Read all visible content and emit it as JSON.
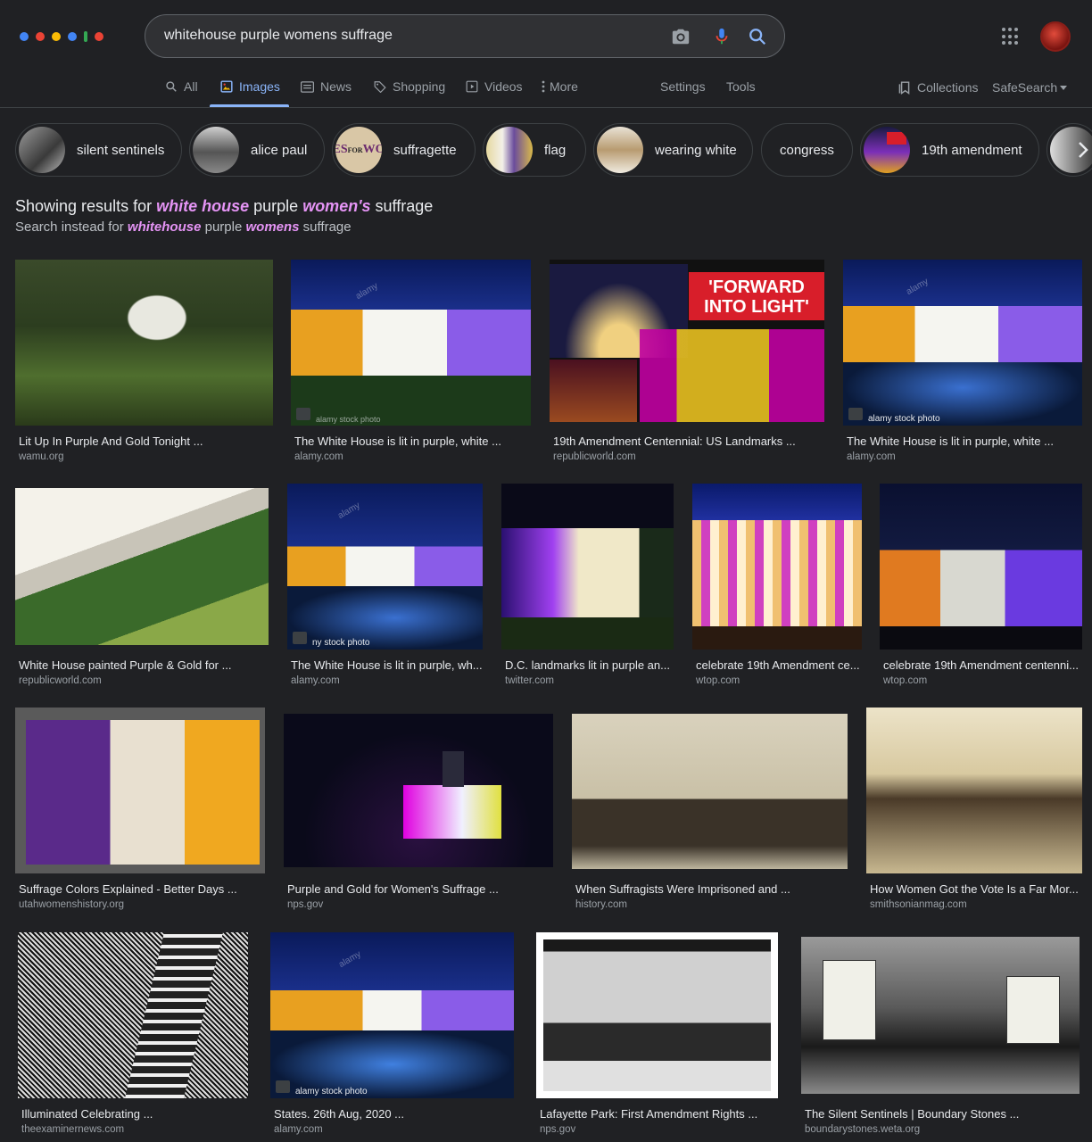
{
  "search": {
    "query": "whitehouse purple womens suffrage"
  },
  "colors": {
    "background": "#202124",
    "accent": "#8ab4f8",
    "highlight": "#e594f5"
  },
  "header_icons": [
    "camera-icon",
    "microphone-icon",
    "search-icon",
    "apps-icon"
  ],
  "tabs": [
    {
      "label": "All",
      "icon": "search-icon"
    },
    {
      "label": "Images",
      "icon": "image-icon",
      "active": true
    },
    {
      "label": "News",
      "icon": "news-icon"
    },
    {
      "label": "Shopping",
      "icon": "tag-icon"
    },
    {
      "label": "Videos",
      "icon": "play-icon"
    },
    {
      "label": "More",
      "icon": "more-vert-icon"
    },
    {
      "label": "Settings"
    },
    {
      "label": "Tools"
    }
  ],
  "right_links": {
    "collections": "Collections",
    "safesearch": "SafeSearch"
  },
  "chips": [
    "silent sentinels",
    "alice paul",
    "suffragette",
    "flag",
    "wearing white",
    "congress",
    "19th amendment"
  ],
  "correction": {
    "showing_prefix": "Showing results for",
    "showing_b1": "white house",
    "showing_mid": "purple",
    "showing_b2": "women's",
    "showing_end": "suffrage",
    "instead_prefix": "Search instead for",
    "instead_b1": "whitehouse",
    "instead_mid": "purple",
    "instead_b2": "womens",
    "instead_end": "suffrage"
  },
  "results": [
    {
      "title": "Lit Up In Purple And Gold Tonight ...",
      "source": "wamu.org"
    },
    {
      "title": "The White House is lit in purple, white ...",
      "source": "alamy.com",
      "watermark": "alamy",
      "stock_label": "alamy stock photo"
    },
    {
      "title": "19th Amendment Centennial: US Landmarks ...",
      "source": "republicworld.com",
      "overlay": "'FORWARD INTO LIGHT'"
    },
    {
      "title": "The White House is lit in purple, white ...",
      "source": "alamy.com",
      "watermark": "alamy",
      "stock_label": "alamy stock photo"
    },
    {
      "title": "White House painted Purple & Gold for ...",
      "source": "republicworld.com"
    },
    {
      "title": "The White House is lit in purple, wh...",
      "source": "alamy.com",
      "watermark": "alamy",
      "stock_label": "ny stock photo"
    },
    {
      "title": "D.C. landmarks lit in purple an...",
      "source": "twitter.com"
    },
    {
      "title": "celebrate 19th Amendment ce...",
      "source": "wtop.com"
    },
    {
      "title": "celebrate 19th Amendment centenni...",
      "source": "wtop.com"
    },
    {
      "title": "Suffrage Colors Explained - Better Days ...",
      "source": "utahwomenshistory.org"
    },
    {
      "title": "Purple and Gold for Women's Suffrage ...",
      "source": "nps.gov"
    },
    {
      "title": "When Suffragists Were Imprisoned and ...",
      "source": "history.com"
    },
    {
      "title": "How Women Got the Vote Is a Far Mor...",
      "source": "smithsonianmag.com"
    },
    {
      "title": "Illuminated Celebrating ...",
      "source": "theexaminernews.com"
    },
    {
      "title": "States. 26th Aug, 2020 ...",
      "source": "alamy.com",
      "watermark": "alamy",
      "stock_label": "alamy stock photo"
    },
    {
      "title": "Lafayette Park: First Amendment Rights ...",
      "source": "nps.gov"
    },
    {
      "title": "The Silent Sentinels | Boundary Stones ...",
      "source": "boundarystones.weta.org"
    }
  ]
}
